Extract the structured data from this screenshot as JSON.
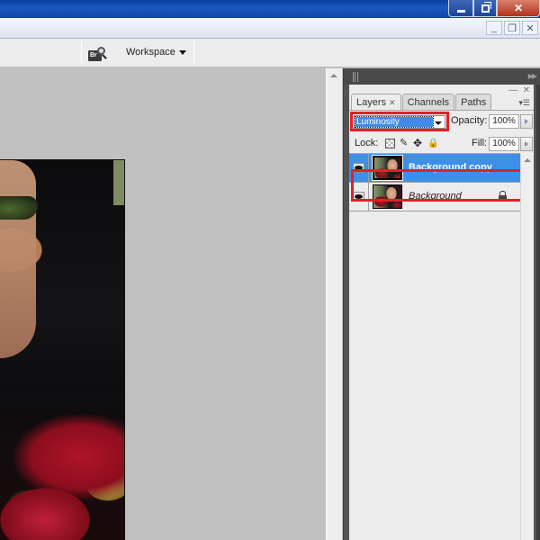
{
  "window": {
    "controls": {
      "minimize": "minimize",
      "restore": "restore",
      "close": "close"
    }
  },
  "document_controls": {
    "minimize": "_",
    "restore": "❐",
    "close": "✕"
  },
  "options_bar": {
    "bridge_icon_label": "Br",
    "workspace_label": "Workspace"
  },
  "layers_panel": {
    "tabs": [
      {
        "label": "Layers",
        "active": true,
        "closable": true
      },
      {
        "label": "Channels",
        "active": false
      },
      {
        "label": "Paths",
        "active": false
      }
    ],
    "blend_mode": "Luminosity",
    "opacity_label": "Opacity:",
    "opacity_value": "100%",
    "lock_label": "Lock:",
    "fill_label": "Fill:",
    "fill_value": "100%",
    "layers": [
      {
        "name": "Background copy",
        "visible": true,
        "selected": true,
        "locked": false
      },
      {
        "name": "Background",
        "visible": true,
        "selected": false,
        "locked": true
      }
    ]
  },
  "colors": {
    "selection_highlight": "#e0202a",
    "selected_layer": "#3d8fe8",
    "panel_bg": "#ececec",
    "canvas_bg": "#c0c0c0"
  }
}
